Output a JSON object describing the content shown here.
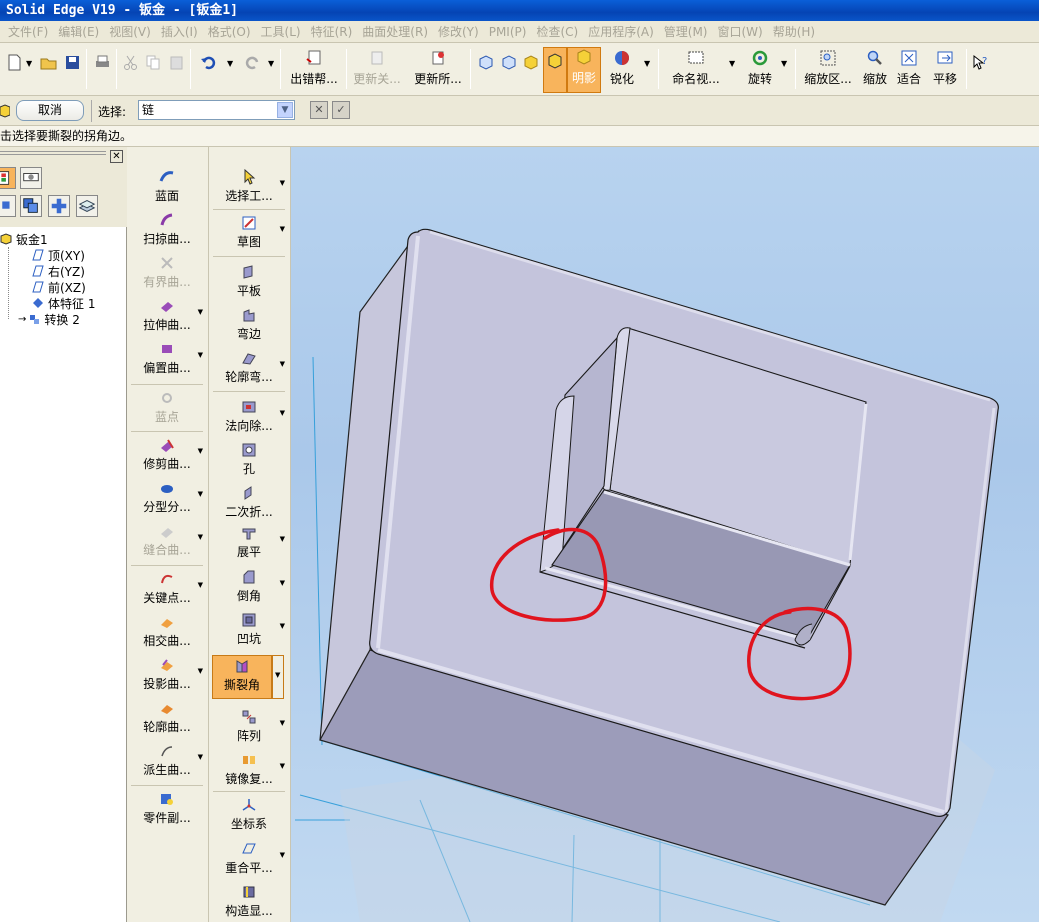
{
  "window": {
    "title": "Solid Edge V19 - 钣金 - [钣金1]"
  },
  "menu": [
    "文件(F)",
    "编辑(E)",
    "视图(V)",
    "插入(I)",
    "格式(O)",
    "工具(L)",
    "特征(R)",
    "曲面处理(R)",
    "修改(Y)",
    "PMI(P)",
    "检查(C)",
    "应用程序(A)",
    "管理(M)",
    "窗口(W)",
    "帮助(H)"
  ],
  "toolbar": {
    "error_help": "出错帮...",
    "update_rel": "更新关...",
    "update_all": "更新所...",
    "shade": "明影",
    "sharpen": "锐化",
    "named_view": "命名视...",
    "rotate": "旋转",
    "zoom_area": "缩放区...",
    "zoom": "缩放",
    "fit": "适合",
    "pan": "平移"
  },
  "cmdbar": {
    "cancel": "取消",
    "select_label": "选择:",
    "select_value": "链"
  },
  "prompt": "击选择要撕裂的拐角边。",
  "tree": {
    "root": "钣金1",
    "items": [
      "顶(XY)",
      "右(YZ)",
      "前(XZ)",
      "体特征 1",
      "转换 2"
    ]
  },
  "ribbon_left": [
    {
      "label": "蓝面",
      "dim": false,
      "arrow": false
    },
    {
      "label": "扫掠曲...",
      "dim": false,
      "arrow": false
    },
    {
      "label": "有界曲...",
      "dim": true,
      "arrow": false
    },
    {
      "label": "拉伸曲...",
      "dim": false,
      "arrow": true
    },
    {
      "label": "偏置曲...",
      "dim": false,
      "arrow": true
    },
    {
      "label": "蓝点",
      "dim": true,
      "arrow": false
    },
    {
      "label": "修剪曲...",
      "dim": false,
      "arrow": true
    },
    {
      "label": "分型分...",
      "dim": false,
      "arrow": true
    },
    {
      "label": "缝合曲...",
      "dim": true,
      "arrow": true
    },
    {
      "label": "关键点...",
      "dim": false,
      "arrow": true
    },
    {
      "label": "相交曲...",
      "dim": false,
      "arrow": false
    },
    {
      "label": "投影曲...",
      "dim": false,
      "arrow": true
    },
    {
      "label": "轮廓曲...",
      "dim": false,
      "arrow": false
    },
    {
      "label": "派生曲...",
      "dim": false,
      "arrow": true
    },
    {
      "label": "零件副...",
      "dim": false,
      "arrow": false
    }
  ],
  "ribbon_right": [
    {
      "label": "选择工...",
      "arrow": true
    },
    {
      "label": "草图",
      "arrow": true
    },
    {
      "label": "平板",
      "arrow": false
    },
    {
      "label": "弯边",
      "arrow": false
    },
    {
      "label": "轮廓弯...",
      "arrow": true
    },
    {
      "label": "法向除...",
      "arrow": true
    },
    {
      "label": "孔",
      "arrow": false
    },
    {
      "label": "二次折...",
      "arrow": false
    },
    {
      "label": "展平",
      "arrow": true
    },
    {
      "label": "倒角",
      "arrow": true
    },
    {
      "label": "凹坑",
      "arrow": true
    },
    {
      "label": "撕裂角",
      "arrow": true,
      "active": true
    },
    {
      "label": "阵列",
      "arrow": true
    },
    {
      "label": "镜像复...",
      "arrow": true
    },
    {
      "label": "坐标系",
      "arrow": false
    },
    {
      "label": "重合平...",
      "arrow": true
    },
    {
      "label": "构造显...",
      "arrow": false
    }
  ],
  "colors": {
    "accent": "#f8b45c",
    "highlight_circle": "#e0141e",
    "part": "#c3c3dc"
  }
}
